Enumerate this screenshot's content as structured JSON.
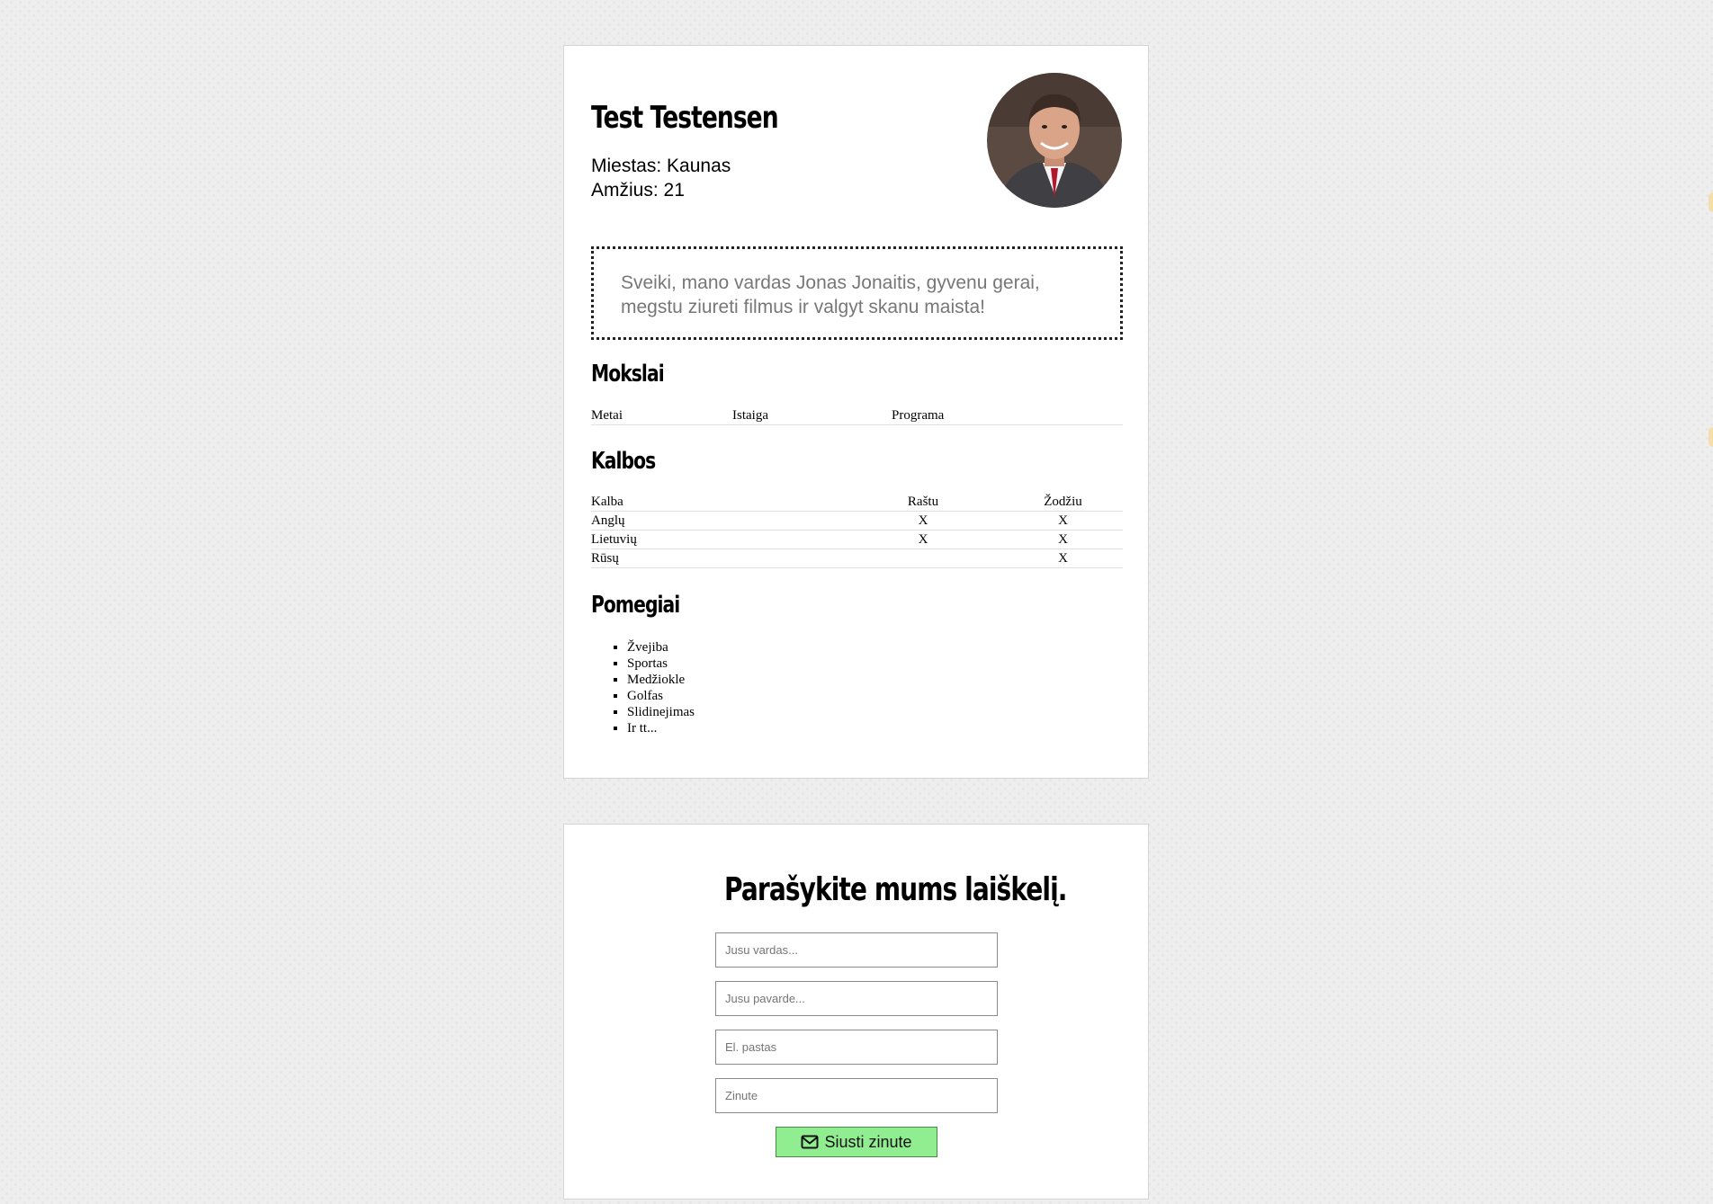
{
  "profile": {
    "name": "Test Testensen",
    "city": "Miestas: Kaunas",
    "age": "Amžius: 21",
    "about": "Sveiki, mano vardas Jonas Jonaitis, gyvenu gerai, megstu ziureti filmus ir valgyt skanu maista!"
  },
  "education": {
    "heading": "Mokslai",
    "columns": [
      "Metai",
      "Istaiga",
      "Programa"
    ]
  },
  "languages": {
    "heading": "Kalbos",
    "columns": [
      "Kalba",
      "Raštu",
      "Žodžiu"
    ],
    "rows": [
      [
        "Anglų",
        "X",
        "X"
      ],
      [
        "Lietuvių",
        "X",
        "X"
      ],
      [
        "Rūsų",
        "",
        "X"
      ]
    ]
  },
  "hobbies": {
    "heading": "Pomegiai",
    "items": [
      "Žvejiba",
      "Sportas",
      "Medžiokle",
      "Golfas",
      "Slidinejimas",
      "Ir tt..."
    ]
  },
  "contact": {
    "heading": "Parašykite mums laiškelį.",
    "name_placeholder": "Jusu vardas...",
    "surname_placeholder": "Jusu pavarde...",
    "email_placeholder": "El. pastas",
    "message_placeholder": "Zinute",
    "send_label": "Siusti zinute",
    "send_icon": "envelope-icon",
    "send_color": "#90ee90"
  }
}
